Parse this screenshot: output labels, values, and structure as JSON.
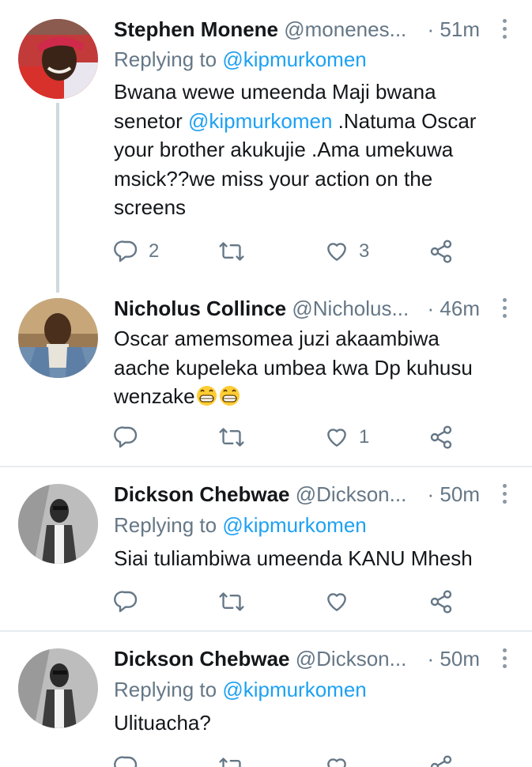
{
  "tweets": [
    {
      "name": "Stephen Monene",
      "handle": "@monenes...",
      "time": "· 51m",
      "replying_prefix": "Replying to ",
      "replying_to": "@kipmurkomen",
      "text_lines": [
        "Bwana wewe umeenda Maji bwana",
        "senetor ",
        "@kipmurkomen",
        " .Natuma Oscar",
        "your brother akukujie .Ama umekuwa",
        "msick??we miss your action on the",
        "screens"
      ],
      "reply_count": "2",
      "like_count": "3"
    },
    {
      "name": "Nicholus Collince",
      "handle": "@Nicholus...",
      "time": "· 46m",
      "text_lines": [
        "Oscar amemsomea juzi akaambiwa",
        "aache kupeleka umbea kwa Dp kuhusu",
        "wenzake"
      ],
      "emoji": "😁😁",
      "reply_count": "",
      "like_count": "1"
    },
    {
      "name": "Dickson Chebwae",
      "handle": "@Dickson...",
      "time": "· 50m",
      "replying_prefix": "Replying to ",
      "replying_to": "@kipmurkomen",
      "text": "Siai tuliambiwa umeenda KANU Mhesh"
    },
    {
      "name": "Dickson Chebwae",
      "handle": "@Dickson...",
      "time": "· 50m",
      "replying_prefix": "Replying to ",
      "replying_to": "@kipmurkomen",
      "text": "Ulituacha?"
    }
  ],
  "colors": {
    "link": "#1da1f2",
    "secondary": "#657786",
    "divider": "#e6ecf0",
    "thread_line": "#cfd9de"
  },
  "icons": [
    "reply-icon",
    "retweet-icon",
    "like-icon",
    "share-icon",
    "more-icon"
  ]
}
